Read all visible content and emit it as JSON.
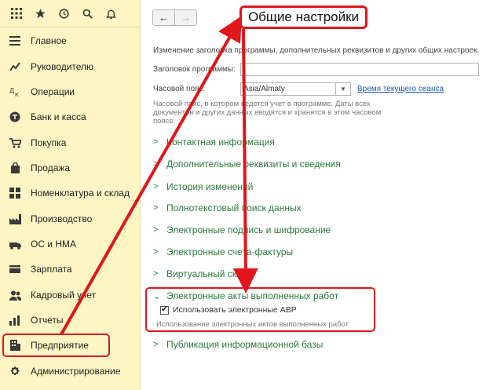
{
  "sidebar": {
    "top_icons": [
      "menu-icon",
      "star-icon",
      "history-icon",
      "search-icon",
      "bell-icon"
    ],
    "items": [
      {
        "label": "Главное",
        "icon": "list-icon"
      },
      {
        "label": "Руководителю",
        "icon": "chart-icon"
      },
      {
        "label": "Операции",
        "icon": "accounting-icon"
      },
      {
        "label": "Банк и касса",
        "icon": "coin-icon"
      },
      {
        "label": "Покупка",
        "icon": "cart-icon"
      },
      {
        "label": "Продажа",
        "icon": "bag-icon"
      },
      {
        "label": "Номенклатура и склад",
        "icon": "grid-icon"
      },
      {
        "label": "Производство",
        "icon": "factory-icon"
      },
      {
        "label": "ОС и НМА",
        "icon": "assets-icon"
      },
      {
        "label": "Зарплата",
        "icon": "wallet-icon"
      },
      {
        "label": "Кадровый учет",
        "icon": "people-icon"
      },
      {
        "label": "Отчеты",
        "icon": "bar-chart-icon"
      },
      {
        "label": "Предприятие",
        "icon": "building-icon"
      },
      {
        "label": "Администрирование",
        "icon": "gear-icon"
      }
    ]
  },
  "main": {
    "title": "Общие настройки",
    "description": "Изменение заголовка программы, дополнительных реквизитов и других общих настроек.",
    "header_field": {
      "label": "Заголовок программы:",
      "value": ""
    },
    "timezone": {
      "label": "Часовой пояс:",
      "value": "Asia/Almaty",
      "link": "Время текущего сеанса"
    },
    "timezone_hint": "Часовой пояс, в котором ведется учет в программе. Даты всех документов и других данных вводятся и хранятся в этом часовом поясе.",
    "sections": [
      {
        "label": "Контактная информация",
        "expanded": false
      },
      {
        "label": "Дополнительные реквизиты и сведения",
        "expanded": false
      },
      {
        "label": "История изменений",
        "expanded": false
      },
      {
        "label": "Полнотекстовый поиск данных",
        "expanded": false
      },
      {
        "label": "Электронные подпись и шифрование",
        "expanded": false
      },
      {
        "label": "Электронные счета-фактуры",
        "expanded": false
      },
      {
        "label": "Виртуальный склад",
        "expanded": false
      },
      {
        "label": "Электронные акты выполненных работ",
        "expanded": true
      },
      {
        "label": "Публикация информационной базы",
        "expanded": false
      }
    ],
    "avr_checkbox": {
      "label": "Использовать электронные АВР",
      "checked": true
    },
    "avr_note": "Использование электронных актов выполненных работ"
  },
  "annotation": {
    "color": "#e0161c"
  }
}
